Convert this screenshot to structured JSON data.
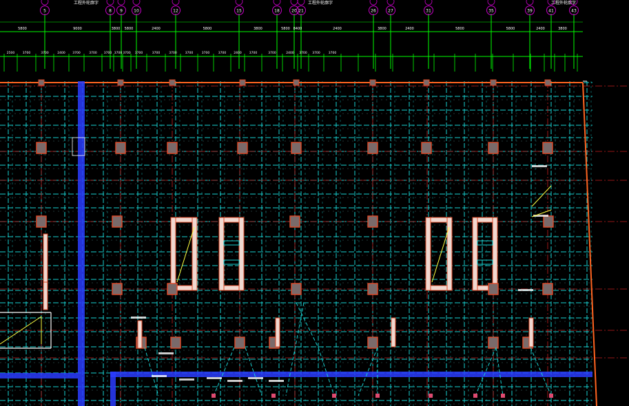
{
  "drawing": {
    "background": "#000000",
    "colors": {
      "axis_bubble": "#c800c8",
      "axis_label": "#ffffff",
      "dimension": "#00ff00",
      "dim_text": "#ffffff",
      "grid_dash": "#19d2d2",
      "grid_solid": "#7fd7d7",
      "red_line": "#c81e1e",
      "outline": "#ff6420",
      "column_fill": "#7a6a6a",
      "column_edge": "#e04a28",
      "blue_band": "#2a3cff",
      "wall_fill": "#f0d8d0",
      "stair_line": "#ffff40",
      "white": "#ffffff"
    },
    "axes": [
      {
        "label": "5"
      },
      {
        "label": "8"
      },
      {
        "label": "9"
      },
      {
        "label": "10"
      },
      {
        "label": "12"
      },
      {
        "label": "15"
      },
      {
        "label": "18"
      },
      {
        "label": "20"
      },
      {
        "label": "21"
      },
      {
        "label": "26"
      },
      {
        "label": "27"
      },
      {
        "label": "31"
      },
      {
        "label": "35"
      },
      {
        "label": "39"
      },
      {
        "label": "41"
      },
      {
        "label": "43"
      }
    ],
    "top_notes": [
      {
        "text": "工程外轮廓字"
      },
      {
        "text": "工程外轮廓字"
      },
      {
        "text": "工程外轮廓字"
      }
    ],
    "dim_row1": [
      "5800",
      "9000",
      "3800",
      "5800",
      "2400",
      "5800",
      "3800",
      "5800",
      "8400",
      "2400",
      "3800",
      "2400",
      "5800",
      "5800",
      "2400",
      "3800"
    ],
    "dim_row2": [
      "2500",
      "3700",
      "3700",
      "2400",
      "3700",
      "3700",
      "3700",
      "3700",
      "3700",
      "3700",
      "3700",
      "3700",
      "3700",
      "3700",
      "3700",
      "2400",
      "3700",
      "3700",
      "2400",
      "3700",
      "3700",
      "3700"
    ]
  }
}
